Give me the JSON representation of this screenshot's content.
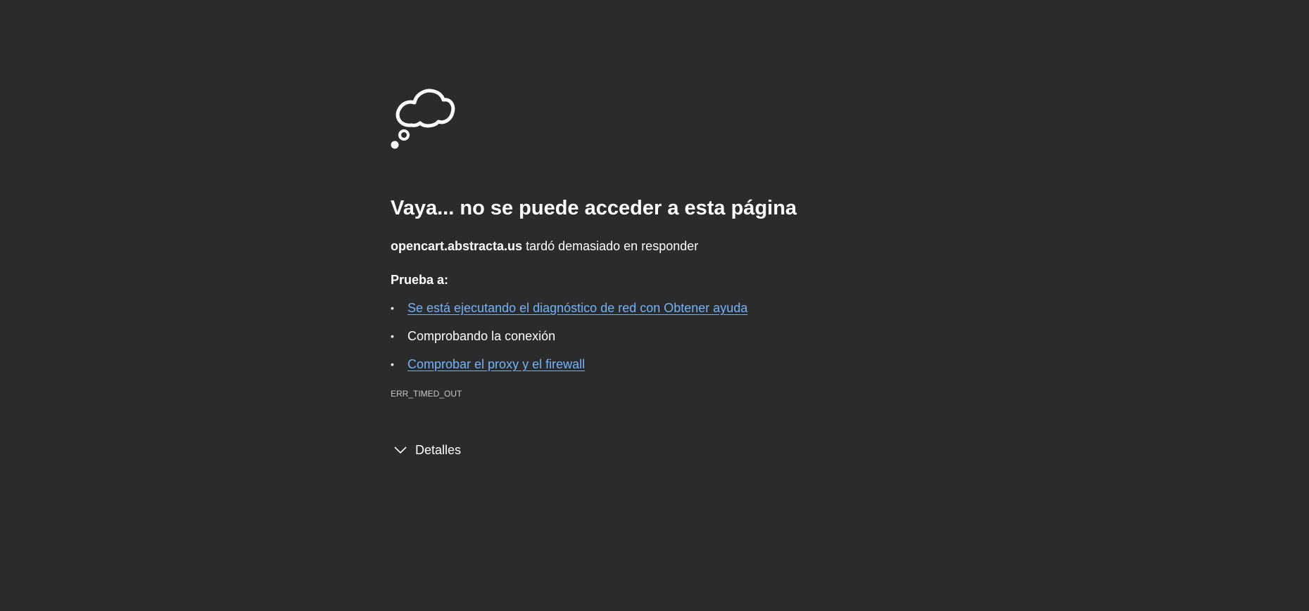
{
  "error_page": {
    "icon": "thought-cloud-icon",
    "title": "Vaya... no se puede acceder a esta página",
    "host": "opencart.abstracta.us",
    "host_message": " tardó demasiado en responder",
    "try_heading": "Prueba a:",
    "bullet_glyph": "•",
    "suggestions": [
      {
        "label": "Se está ejecutando el diagnóstico de red con Obtener ayuda",
        "is_link": true
      },
      {
        "label": "Comprobando la conexión",
        "is_link": false
      },
      {
        "label": "Comprobar el proxy y el firewall",
        "is_link": true
      }
    ],
    "error_code": "ERR_TIMED_OUT",
    "details_label": "Detalles",
    "details_icon": "chevron-down-icon"
  },
  "colors": {
    "background": "#2b2b2b",
    "text": "#ffffff",
    "link": "#70b4ff",
    "muted": "#c8c8c8"
  }
}
